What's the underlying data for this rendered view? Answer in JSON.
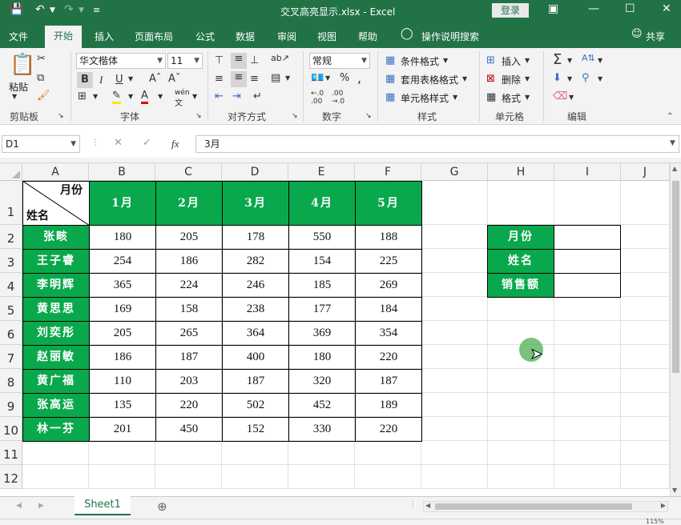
{
  "window": {
    "title": "交叉高亮显示.xlsx  -  Excel",
    "login": "登录"
  },
  "tabs": [
    "文件",
    "开始",
    "插入",
    "页面布局",
    "公式",
    "数据",
    "审阅",
    "视图",
    "帮助"
  ],
  "tell_me": "操作说明搜索",
  "share": "共享",
  "ribbon": {
    "paste": "粘贴",
    "font_name": "华文楷体",
    "font_size": "11",
    "number_format": "常规",
    "cond_format": "条件格式",
    "table_format": "套用表格格式",
    "cell_style": "单元格样式",
    "insert": "插入",
    "delete": "删除",
    "format": "格式",
    "groups": {
      "clipboard": "剪贴板",
      "font": "字体",
      "align": "对齐方式",
      "number": "数字",
      "style": "样式",
      "cells": "单元格",
      "edit": "编辑"
    },
    "wen": "wén"
  },
  "formula_bar": {
    "name_box": "D1",
    "content": "3月"
  },
  "columns": [
    "A",
    "B",
    "C",
    "D",
    "E",
    "F",
    "G",
    "H",
    "I",
    "J"
  ],
  "rows": [
    "1",
    "2",
    "3",
    "4",
    "5",
    "6",
    "7",
    "8",
    "9",
    "10",
    "11",
    "12"
  ],
  "table": {
    "corner_top": "月份",
    "corner_bottom": "姓名",
    "months": [
      "1月",
      "2月",
      "3月",
      "4月",
      "5月"
    ],
    "names": [
      "张畡",
      "王子睿",
      "李明辉",
      "黄思思",
      "刘奕彤",
      "赵丽敏",
      "黄广福",
      "张高运",
      "林一芬"
    ],
    "values": [
      [
        180,
        205,
        178,
        550,
        188
      ],
      [
        254,
        186,
        282,
        154,
        225
      ],
      [
        365,
        224,
        246,
        185,
        269
      ],
      [
        169,
        158,
        238,
        177,
        184
      ],
      [
        205,
        265,
        364,
        369,
        354
      ],
      [
        186,
        187,
        400,
        180,
        220
      ],
      [
        110,
        203,
        187,
        320,
        187
      ],
      [
        135,
        220,
        502,
        452,
        189
      ],
      [
        201,
        450,
        152,
        330,
        220
      ]
    ]
  },
  "lookup": {
    "labels": [
      "月份",
      "姓名",
      "销售额"
    ]
  },
  "sheet_tab": "Sheet1",
  "status": {
    "zoom": "115%"
  },
  "colors": {
    "excel_green": "#217346",
    "header_green": "#0aa84c",
    "cursor_dot": "#4caf50"
  }
}
